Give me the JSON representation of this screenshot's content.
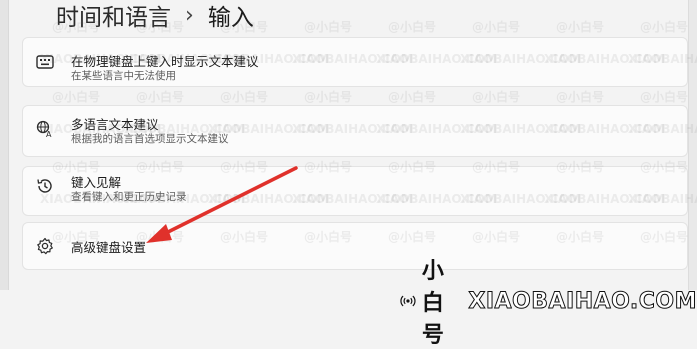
{
  "breadcrumb": {
    "parent": "时间和语言",
    "separator": "›",
    "current": "输入"
  },
  "settings": [
    {
      "icon": "keyboard-icon",
      "title": "在物理键盘上键入时显示文本建议",
      "desc": "在某些语言中无法使用"
    },
    {
      "icon": "language-icon",
      "title": "多语言文本建议",
      "desc": "根据我的语言首选项显示文本建议"
    },
    {
      "icon": "history-icon",
      "title": "键入见解",
      "desc": "查看键入和更正历史记录"
    },
    {
      "icon": "gear-icon",
      "title": "高级键盘设置",
      "desc": ""
    }
  ],
  "watermark": {
    "handle": "@小白号",
    "site": "XIAOBAIHAO.COM"
  },
  "brand": {
    "name": "小白号",
    "site": "XIAOBAIHAO.COM"
  },
  "colors": {
    "arrow": "#e0312b",
    "background": "#f3f3f3",
    "card": "#fbfbfb"
  }
}
